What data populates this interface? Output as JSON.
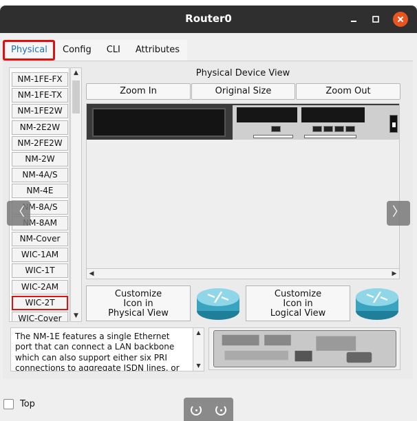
{
  "window": {
    "title": "Router0"
  },
  "window_controls": {
    "minimize_icon": "minimize-icon",
    "maximize_icon": "maximize-icon",
    "close_icon": "close-icon"
  },
  "tabs": [
    {
      "label": "Physical",
      "active": true
    },
    {
      "label": "Config"
    },
    {
      "label": "CLI"
    },
    {
      "label": "Attributes"
    }
  ],
  "modules": [
    "NM-1FE-FX",
    "NM-1FE-TX",
    "NM-1FE2W",
    "NM-2E2W",
    "NM-2FE2W",
    "NM-2W",
    "NM-4A/S",
    "NM-4E",
    "NM-8A/S",
    "NM-8AM",
    "NM-Cover",
    "WIC-1AM",
    "WIC-1T",
    "WIC-2AM",
    "WIC-2T",
    "WIC-Cover"
  ],
  "highlighted_module": "WIC-2T",
  "physical_view": {
    "title": "Physical Device View",
    "zoom_in": "Zoom In",
    "original_size": "Original Size",
    "zoom_out": "Zoom Out"
  },
  "customize": {
    "physical_line1": "Customize",
    "physical_line2": "Icon in",
    "physical_line3": "Physical View",
    "logical_line1": "Customize",
    "logical_line2": "Icon in",
    "logical_line3": "Logical View"
  },
  "description": {
    "line1": "The NM-1E features a single Ethernet",
    "line2": "port that can connect a LAN backbone",
    "line3": "which can also support either six PRI",
    "line4": "connections to aggregate ISDN lines, or"
  },
  "footer": {
    "top_label": "Top",
    "top_checked": false
  },
  "colors": {
    "titlebar": "#2f2f2f",
    "close": "#e95420",
    "highlight": "#e01010",
    "active_tab_text": "#1f6fbf"
  }
}
